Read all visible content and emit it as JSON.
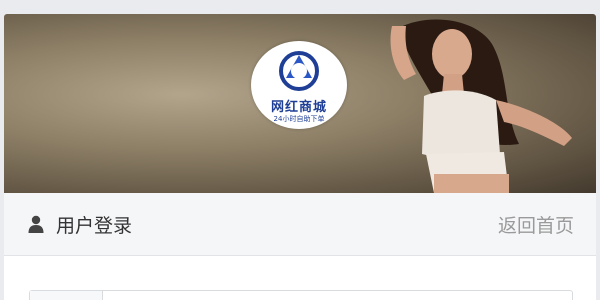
{
  "banner": {
    "logo": {
      "title": "网红商城",
      "subtitle": "24小时自助下单",
      "brand_color": "#1f3f97"
    }
  },
  "header": {
    "title": "用户登录",
    "home_link": "返回首页"
  },
  "icons": {
    "user": "user-icon"
  }
}
